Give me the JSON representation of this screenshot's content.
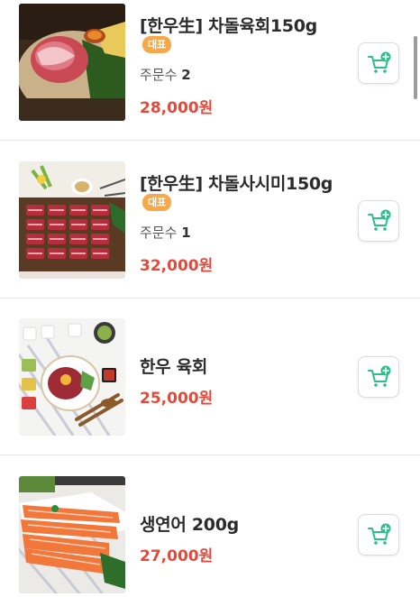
{
  "theme": {
    "price_color": "#e04b3c",
    "badge_color": "#f5a94a",
    "cart_icon_color": "#2bbf8a"
  },
  "products": [
    {
      "name": "[한우生] 차돌육회150g",
      "badge": "대표",
      "orders_label": "주문수",
      "orders_count": "2",
      "price": "28,000원",
      "image": "beef-yukhoe-plate-image",
      "cart_icon": "add-to-cart-icon"
    },
    {
      "name": "[한우生] 차돌사시미150g",
      "badge": "대표",
      "orders_label": "주문수",
      "orders_count": "1",
      "price": "32,000원",
      "image": "beef-sashimi-board-image",
      "cart_icon": "add-to-cart-icon"
    },
    {
      "name": "한우 육회",
      "price": "25,000원",
      "image": "hanwoo-yukhoe-table-image",
      "cart_icon": "add-to-cart-icon"
    },
    {
      "name": "생연어 200g",
      "price": "27,000원",
      "image": "salmon-sashimi-image",
      "cart_icon": "add-to-cart-icon"
    }
  ]
}
